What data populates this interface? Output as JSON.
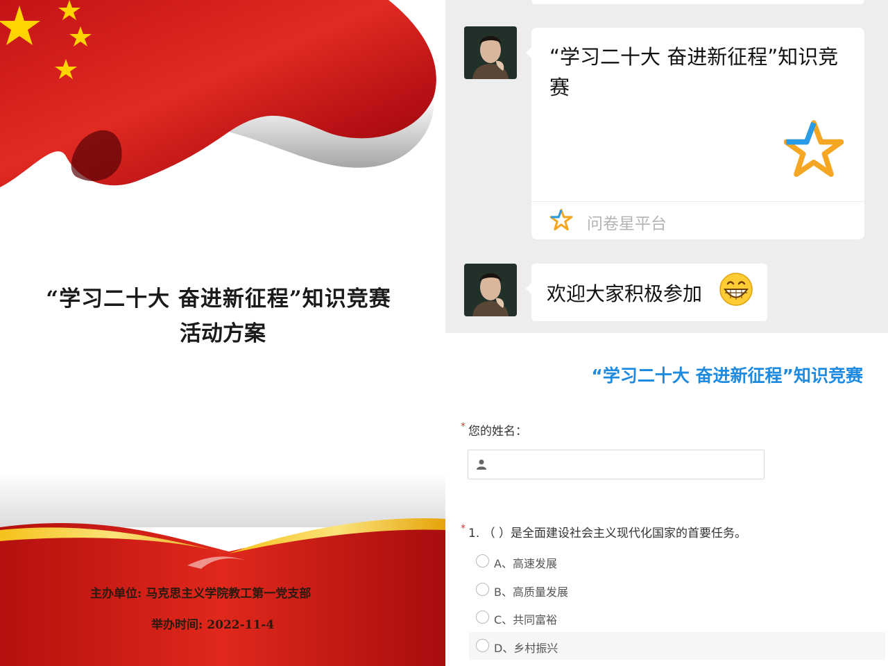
{
  "cover": {
    "title_line1": "“学习二十大  奋进新征程”知识竞赛",
    "title_line2": "活动方案",
    "organizer_label": "主办单位:",
    "organizer_value": "马克思主义学院教工第一党支部",
    "date_label": "举办时间:",
    "date_value": "2022-11-4",
    "flag_icon": "chinese-flag-wave",
    "colors": {
      "flag_red": "#d21a1a",
      "star_yellow": "#ffd400",
      "ribbon_gold": "#f1b40f"
    }
  },
  "chat": {
    "card": {
      "title": "“学习二十大 奋进新征程”知识竞赛",
      "icon": "star-logo-icon",
      "source": "问卷星平台"
    },
    "message": {
      "text": "欢迎大家积极参加",
      "emoji": "grinning-face-emoji"
    }
  },
  "form": {
    "title": "“学习二十大 奋进新征程”知识竞赛",
    "required_mark": "*",
    "name_label": "您的姓名：",
    "name_value": "",
    "question1": {
      "label": "1. （   ）是全面建设社会主义现代化国家的首要任务。",
      "options": [
        "A、高速发展",
        "B、高质量发展",
        "C、共同富裕",
        "D、乡村振兴"
      ]
    },
    "colors": {
      "accent": "#1e8ae0",
      "required": "#e03434"
    }
  }
}
